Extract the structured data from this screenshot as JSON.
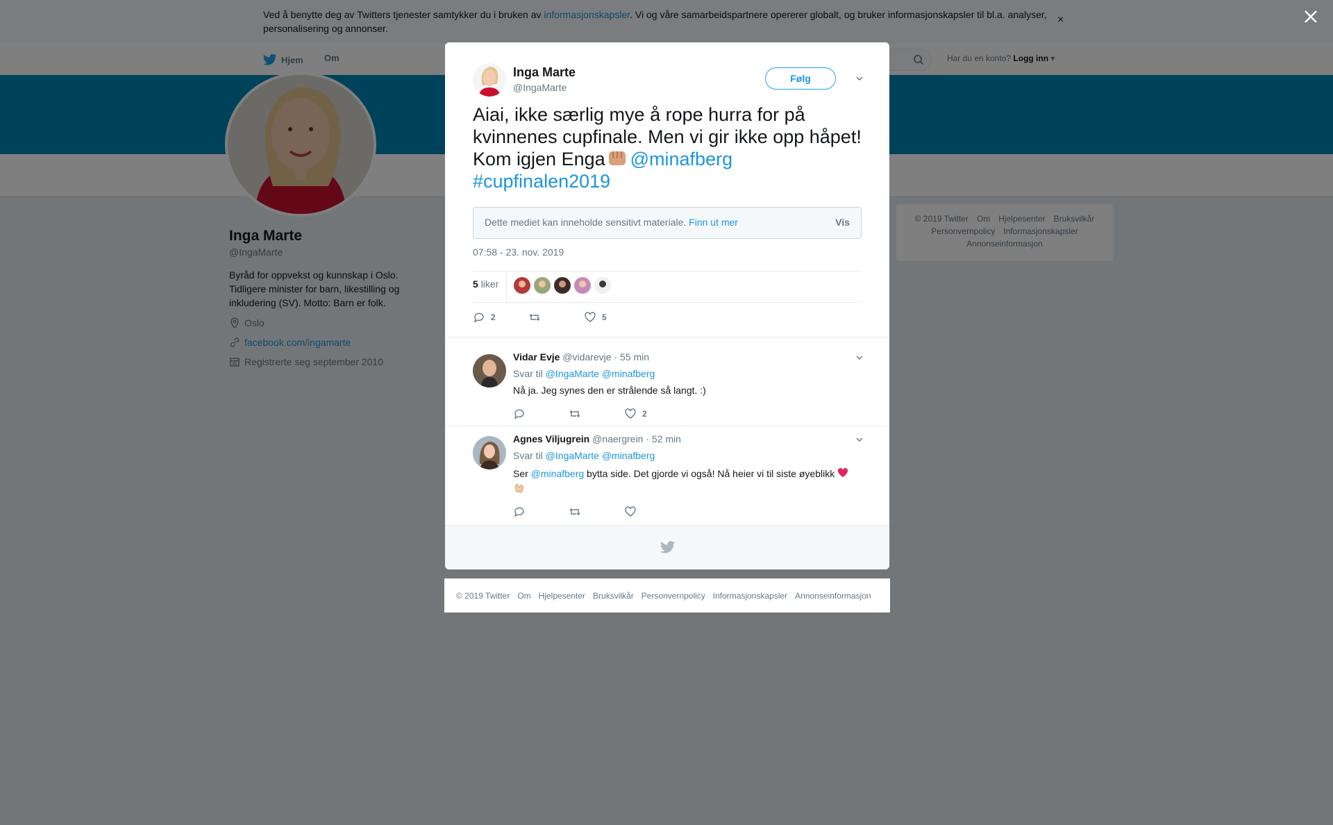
{
  "cookie_banner": {
    "text_before": "Ved å benytte deg av Twitters tjenester samtykker du i bruken av ",
    "link": "informasjonskapsler",
    "text_after": ". Vi og våre samarbeidspartnere opererer globalt, og bruker informasjonskapsler til bl.a. analyser, personalisering og annonser.",
    "close": "×"
  },
  "nav": {
    "home": "Hjem",
    "about": "Om",
    "login_prompt": "Har du en konto?",
    "login": "Logg inn"
  },
  "profile": {
    "name": "Inga Marte",
    "handle": "@IngaMarte",
    "bio": "Byråd for oppvekst og kunnskap i Oslo. Tidligere minister for barn, likestilling og inkludering (SV). Motto: Barn er folk.",
    "location": "Oslo",
    "website": "facebook.com/ingamarte",
    "joined": "Registrerte seg september 2010"
  },
  "side_footer": {
    "line1": [
      "© 2019 Twitter",
      "Om",
      "Hjelpesenter",
      "Bruksvilkår"
    ],
    "line2": [
      "Personvernpolicy",
      "Informasjonskapsler"
    ],
    "line3": [
      "Annonseinformasjon"
    ]
  },
  "tweet": {
    "author_name": "Inga Marte",
    "author_handle": "@IngaMarte",
    "follow_label": "Følg",
    "text": "Aiai, ikke særlig mye å rope hurra for på kvinnenes cupfinale. Men vi gir ikke opp håpet! Kom igjen Enga",
    "mention": "@minafberg",
    "hashtag": "#cupfinalen2019",
    "sensitive_text": "Dette mediet kan inneholde sensitivt materiale.",
    "sensitive_link": "Finn ut mer",
    "sensitive_show": "Vis",
    "timestamp": "07:58 - 23. nov. 2019",
    "likes_count": "5",
    "likes_label": "liker",
    "reply_count": "2",
    "like_count": "5"
  },
  "replies": [
    {
      "name": "Vidar Evje",
      "handle": "@vidarevje",
      "time": "· 55 min",
      "reply_to_label": "Svar til",
      "reply_to": "@IngaMarte @minafberg",
      "text": "Nå ja. Jeg synes den er strålende så langt. :)",
      "like_count": "2"
    },
    {
      "name": "Agnes Viljugrein",
      "handle": "@naergrein",
      "time": "· 52 min",
      "reply_to_label": "Svar til",
      "reply_to": "@IngaMarte @minafberg",
      "text_before": "Ser ",
      "mention": "@minafberg",
      "text_after": " bytta side. Det gjorde vi også! Nå heier vi til siste øyeblikk",
      "like_count": ""
    }
  ],
  "bottom_footer": [
    "© 2019 Twitter",
    "Om",
    "Hjelpesenter",
    "Bruksvilkår",
    "Personvernpolicy",
    "Informasjonskapsler",
    "Annonseinformasjon"
  ],
  "colors": {
    "brand": "#1da1f2",
    "link": "#1b95e0",
    "banner": "#0084b4",
    "heart": "#e0245e"
  }
}
